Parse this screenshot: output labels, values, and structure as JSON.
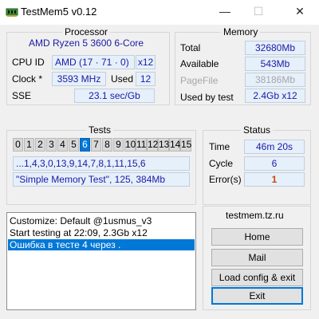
{
  "window": {
    "title": "TestMem5 v0.12",
    "minimize": "—",
    "maximize": "☐",
    "close": "✕"
  },
  "processor": {
    "title": "Processor",
    "name": "AMD Ryzen 5 3600 6-Core",
    "cpuid_label": "CPU ID",
    "cpuid_value": "AMD  (17 · 71 · 0)",
    "threads": "x12",
    "clock_label": "Clock *",
    "clock_value": "3593 MHz",
    "used_label": "Used",
    "used_value": "12",
    "sse_label": "SSE",
    "sse_value": "23.1 sec/Gb"
  },
  "memory": {
    "title": "Memory",
    "total_label": "Total",
    "total_value": "32680Mb",
    "available_label": "Available",
    "available_value": "543Mb",
    "pagefile_label": "PageFile",
    "pagefile_value": "38186Mb",
    "used_by_test_label": "Used by test",
    "used_by_test_value": "2.4Gb x12"
  },
  "tests": {
    "title": "Tests",
    "numbers": [
      "0",
      "1",
      "2",
      "3",
      "4",
      "5",
      "6",
      "7",
      "8",
      "9",
      "10",
      "11",
      "12",
      "13",
      "14",
      "15"
    ],
    "active_index": 6,
    "sequence": "...1,4,3,0,13,9,14,7,8,1,11,15,6",
    "config": "\"Simple Memory Test\", 125, 384Mb"
  },
  "status": {
    "title": "Status",
    "time_label": "Time",
    "time_value": "46m 20s",
    "cycle_label": "Cycle",
    "cycle_value": "6",
    "errors_label": "Error(s)",
    "errors_value": "1"
  },
  "log": {
    "lines": [
      "Customize: Default @1usmus_v3",
      "Start testing at 22:09, 2.3Gb x12",
      "Ошибка в тесте 4 через ."
    ],
    "selected_index": 2
  },
  "actions": {
    "site": "testmem.tz.ru",
    "home": "Home",
    "mail": "Mail",
    "load_config": "Load config & exit",
    "exit": "Exit"
  },
  "colors": {
    "value_text": "#1a1aa6",
    "value_bg": "#e6f0fa",
    "selection": "#0078d7",
    "error": "#c84a00"
  }
}
